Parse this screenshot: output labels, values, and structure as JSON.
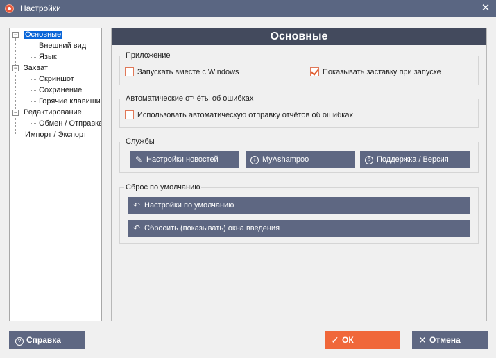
{
  "window": {
    "title": "Настройки",
    "close_glyph": "✕"
  },
  "tree": {
    "items": [
      {
        "label": "Основные",
        "selected": true
      },
      {
        "label": "Внешний вид"
      },
      {
        "label": "Язык"
      },
      {
        "label": "Захват"
      },
      {
        "label": "Скриншот"
      },
      {
        "label": "Сохранение"
      },
      {
        "label": "Горячие клавиши"
      },
      {
        "label": "Редактирование"
      },
      {
        "label": "Обмен / Отправка"
      },
      {
        "label": "Импорт / Экспорт"
      }
    ]
  },
  "panel": {
    "title": "Основные",
    "app_group": {
      "title": "Приложение",
      "start_with_windows": {
        "label": "Запускать вместе с Windows",
        "checked": false
      },
      "show_splash": {
        "label": "Показывать заставку при запуске",
        "checked": true
      }
    },
    "reports_group": {
      "title": "Автоматические отчёты об ошибках",
      "auto_report": {
        "label": "Использовать автоматическую отправку отчётов об ошибках",
        "checked": false
      }
    },
    "services_group": {
      "title": "Службы",
      "news_settings": "Настройки новостей",
      "myashampoo": "MyAshampoo",
      "support": "Поддержка / Версия"
    },
    "reset_group": {
      "title": "Сброс по умолчанию",
      "defaults": "Настройки по умолчанию",
      "reset_intro": "Сбросить (показывать) окна введения"
    }
  },
  "footer": {
    "help": "Справка",
    "ok": "ОК",
    "cancel": "Отмена"
  },
  "colors": {
    "titlebar": "#5a6682",
    "header": "#434a5d",
    "button": "#5e6782",
    "ok": "#f0673a",
    "accent_check": "#e05a2a"
  }
}
